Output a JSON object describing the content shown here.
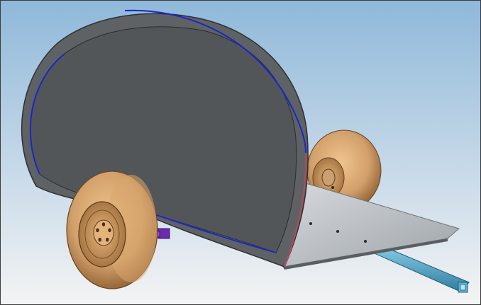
{
  "viewport": {
    "background_top": "#8fb8da",
    "background_bottom": "#f4f4f4",
    "frame_color": "#3b3b3b"
  },
  "model": {
    "shell_color": "#5f6264",
    "shell_dark": "#3a3c3e",
    "outline_accent": "#1e25c8",
    "platform_color": "#b7bcc1",
    "platform_edge": "#6f7478",
    "tongue_color": "#4fa3c4",
    "tire_color": "#d2a06a",
    "tire_shadow": "#8a5a2e",
    "rim_color": "#c08a4e",
    "hub_color": "#e3b37c",
    "bracket_color": "#6a2bb0",
    "edge_stripe": "#b34a5a",
    "bolt_count": 5
  }
}
